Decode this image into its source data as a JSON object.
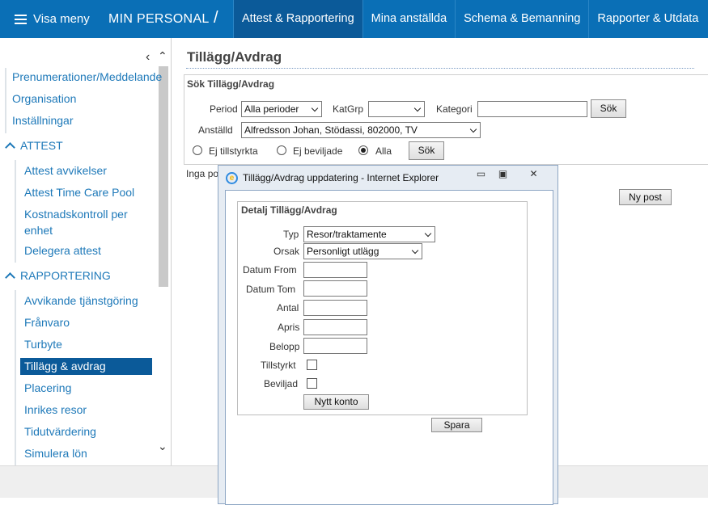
{
  "topbar": {
    "menu_label": "Visa meny",
    "brand": "MIN PERSONAL",
    "separator": "/",
    "tabs": [
      "Attest & Rapportering",
      "Mina anställda",
      "Schema & Bemanning",
      "Rapporter & Utdata"
    ],
    "active_tab": "Attest & Rapportering"
  },
  "sidebar": {
    "top_items": [
      "Prenumerationer/Meddelande",
      "Organisation",
      "Inställningar"
    ],
    "attest_section": "ATTEST",
    "attest_items": [
      "Attest avvikelser",
      "Attest Time Care Pool",
      "Kostnadskontroll per",
      "enhet",
      "Delegera attest"
    ],
    "rapport_section": "RAPPORTERING",
    "rapport_items": [
      "Avvikande tjänstgöring",
      "Frånvaro",
      "Turbyte",
      "Tillägg & avdrag",
      "Placering",
      "Inrikes resor",
      "Tidutvärdering",
      "Simulera lön"
    ],
    "active_item": "Tillägg & avdrag"
  },
  "main": {
    "title": "Tillägg/Avdrag",
    "search": {
      "legend": "Sök Tillägg/Avdrag",
      "period_label": "Period",
      "period_value": "Alla perioder",
      "katgrp_label": "KatGrp",
      "katgrp_value": "",
      "kategori_label": "Kategori",
      "kategori_value": "",
      "sok1_label": "Sök",
      "anstalld_label": "Anställd",
      "anstalld_value": "Alfredsson Johan, Stödassi, 802000, TV",
      "radio_1": "Ej tillstyrkta",
      "radio_2": "Ej beviljade",
      "radio_3": "Alla",
      "selected_radio": "Alla",
      "sok2_label": "Sök"
    },
    "no_posts_text": "Inga po",
    "new_post_label": "Ny post"
  },
  "popup": {
    "title": "Tillägg/Avdrag uppdatering - Internet Explorer",
    "legend": "Detalj Tillägg/Avdrag",
    "typ_label": "Typ",
    "typ_value": "Resor/traktamente",
    "orsak_label": "Orsak",
    "orsak_value": "Personligt utlägg",
    "datum_from_label": "Datum From",
    "datum_tom_label": "Datum Tom",
    "antal_label": "Antal",
    "apris_label": "Apris",
    "belopp_label": "Belopp",
    "tillstyrkt_label": "Tillstyrkt",
    "beviljad_label": "Beviljad",
    "nytt_konto_label": "Nytt konto",
    "spara_label": "Spara",
    "tillstyrkt_checked": false,
    "beviljad_checked": false
  }
}
